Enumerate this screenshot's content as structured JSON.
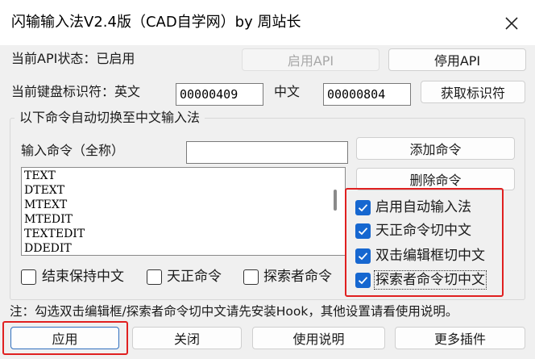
{
  "window": {
    "title": "闪输输入法V2.4版（CAD自学网）by 周站长"
  },
  "status": {
    "label": "当前API状态：已启用",
    "enable_button": "启用API",
    "disable_button": "停用API"
  },
  "keyboard": {
    "label": "当前键盘标识符：英文",
    "english_id": "00000409",
    "chinese_label": "中文",
    "chinese_id": "00000804",
    "fetch_button": "获取标识符"
  },
  "commands": {
    "group_title": "以下命令自动切换至中文输入法",
    "input_label": "输入命令（全称）",
    "input_value": "",
    "add_button": "添加命令",
    "delete_button": "删除命令",
    "list": [
      "TEXT",
      "DTEXT",
      "MTEXT",
      "MTEDIT",
      "TEXTEDIT",
      "DDEDIT"
    ]
  },
  "options": {
    "right": [
      {
        "label": "启用自动输入法",
        "checked": true
      },
      {
        "label": "天正命令切中文",
        "checked": true
      },
      {
        "label": "双击编辑框切中文",
        "checked": true
      },
      {
        "label": "探索者命令切中文",
        "checked": true
      }
    ],
    "bottom": [
      {
        "label": "结束保持中文",
        "checked": false
      },
      {
        "label": "天正命令",
        "checked": false
      },
      {
        "label": "探索者命令",
        "checked": false
      }
    ]
  },
  "note": "注：勾选双击编辑框/探索者命令切中文请先安装Hook，其他设置请看使用说明。",
  "footer": {
    "apply": "应用",
    "close": "关闭",
    "help": "使用说明",
    "more": "更多插件"
  },
  "colors": {
    "accent": "#1667d0",
    "highlight": "#e02020"
  }
}
